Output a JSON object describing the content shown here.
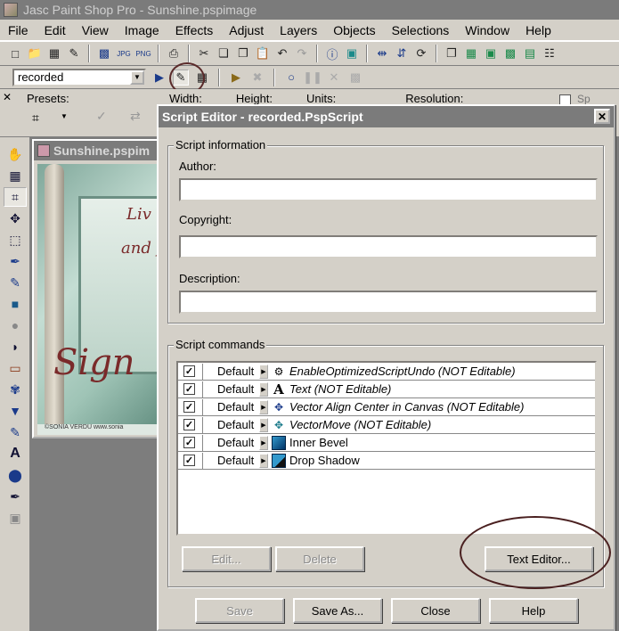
{
  "app": {
    "title": "Jasc Paint Shop Pro - Sunshine.pspimage"
  },
  "menu": [
    "File",
    "Edit",
    "View",
    "Image",
    "Effects",
    "Adjust",
    "Layers",
    "Objects",
    "Selections",
    "Window",
    "Help"
  ],
  "script_toolbar": {
    "script_select_value": "recorded"
  },
  "tool_options": {
    "presets_label": "Presets:",
    "width_label": "Width:",
    "height_label": "Height:",
    "units_label": "Units:",
    "resolution_label": "Resolution:",
    "extra_label": "Sp"
  },
  "document": {
    "title": "Sunshine.pspim",
    "canvas_text_1": "Liv",
    "canvas_text_2": "and f",
    "canvas_text_3": "Sign",
    "footer": "©SONIA VERDU   www.sonia"
  },
  "dialog": {
    "title": "Script Editor - recorded.PspScript",
    "info_group_label": "Script information",
    "author_label": "Author:",
    "author_value": "",
    "copyright_label": "Copyright:",
    "copyright_value": "",
    "description_label": "Description:",
    "description_value": "",
    "commands_group_label": "Script commands",
    "commands": [
      {
        "checked": true,
        "mode": "Default",
        "icon": "optimize-undo-icon",
        "name": "EnableOptimizedScriptUndo (NOT Editable)",
        "italic": true
      },
      {
        "checked": true,
        "mode": "Default",
        "icon": "text-icon",
        "name": "Text (NOT Editable)",
        "italic": true
      },
      {
        "checked": true,
        "mode": "Default",
        "icon": "align-center-icon",
        "name": "Vector Align Center in Canvas (NOT Editable)",
        "italic": true
      },
      {
        "checked": true,
        "mode": "Default",
        "icon": "move-icon",
        "name": "VectorMove (NOT Editable)",
        "italic": true
      },
      {
        "checked": true,
        "mode": "Default",
        "icon": "inner-bevel-icon",
        "name": "Inner Bevel",
        "italic": false
      },
      {
        "checked": true,
        "mode": "Default",
        "icon": "drop-shadow-icon",
        "name": "Drop Shadow",
        "italic": false
      }
    ],
    "buttons": {
      "edit": "Edit...",
      "delete": "Delete",
      "text_editor": "Text Editor...",
      "save": "Save",
      "save_as": "Save As...",
      "close": "Close",
      "help": "Help"
    }
  },
  "colors": {
    "chrome": "#d4d0c8",
    "titlebar_inactive": "#7b7b7b",
    "annotation_circle": "#4a2020"
  }
}
